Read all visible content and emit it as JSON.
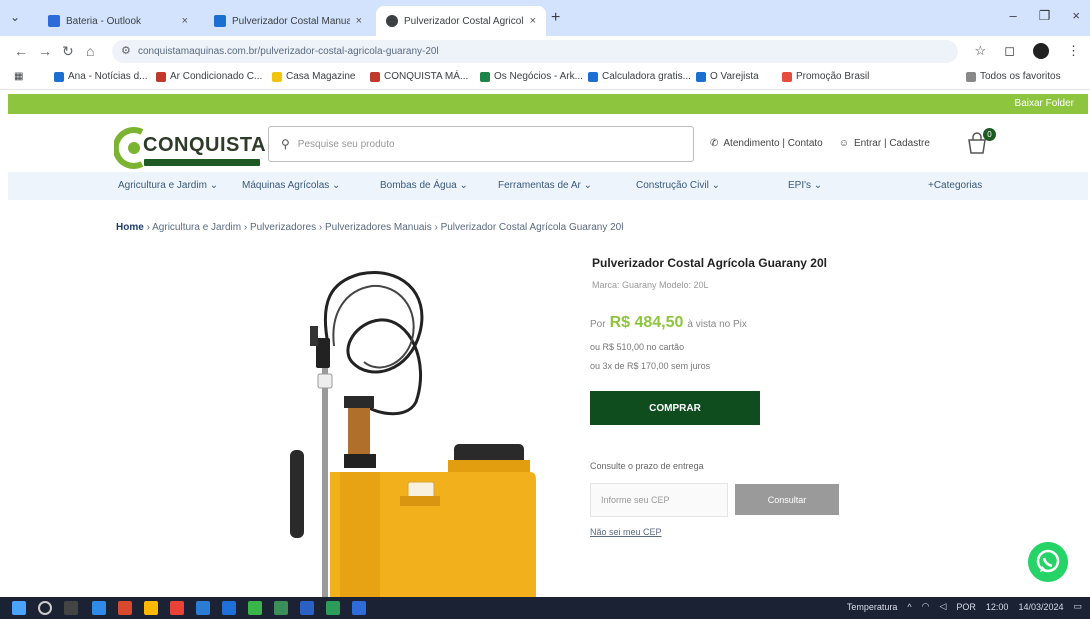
{
  "browser": {
    "tabs": [
      {
        "title": "Bateria - Outlook",
        "color": "#2b6cd8"
      },
      {
        "title": "Pulverizador Costal Manual Fl...",
        "color": "#1b6fd1"
      },
      {
        "title": "Pulverizador Costal Agricola G...",
        "color": "#3c4043"
      }
    ],
    "close_glyph": "×",
    "new_tab_glyph": "+",
    "url": "conquistamaquinas.com.br/pulverizador-costal-agricola-guarany-20l",
    "window_controls": [
      "–",
      "❐",
      "×"
    ],
    "bookmarks": [
      {
        "label": "Ana - Notícias d...",
        "color": "#1b6fd1"
      },
      {
        "label": "Ar Condicionado C...",
        "color": "#c0392b"
      },
      {
        "label": "Casa Magazine",
        "color": "#f1c40f"
      },
      {
        "label": "CONQUISTA MÁ...",
        "color": "#c0392b"
      },
      {
        "label": "Os Negócios - Ark...",
        "color": "#1e8449"
      },
      {
        "label": "Calculadora gratis...",
        "color": "#1b6fd1"
      },
      {
        "label": "O Varejista",
        "color": "#1b6fd1"
      },
      {
        "label": "Promoção Brasil",
        "color": "#e74c3c"
      },
      {
        "label": "Todos os favoritos",
        "color": "#888888"
      }
    ]
  },
  "site": {
    "topbar_link": "Baixar Folder",
    "logo": {
      "text": "CONQUISTA"
    },
    "search_placeholder": "Pesquise seu produto",
    "header_links": {
      "support": "Atendimento | Contato",
      "account": "Entrar | Cadastre"
    },
    "cart_count": "0",
    "menu": [
      "Agricultura e Jardim ⌄",
      "Máquinas Agrícolas ⌄",
      "Bombas de Água ⌄",
      "Ferramentas de Ar ⌄",
      "Construção Civil ⌄",
      "EPI's ⌄",
      "+Categorias"
    ],
    "breadcrumb": {
      "home": "Home",
      "rest": "› Agricultura e Jardim › Pulverizadores › Pulverizadores Manuais › Pulverizador Costal Agrícola Guarany 20l"
    }
  },
  "product": {
    "title": "Pulverizador Costal Agrícola Guarany 20l",
    "meta": "Marca: Guarany    Modelo: 20L",
    "price_prefix": "Por",
    "price": "R$ 484,50",
    "price_suffix": "à vista no Pix",
    "installment_line": "ou R$ 510,00 no cartão",
    "installment_line2": "ou 3x de R$ 170,00 sem juros",
    "buy_label": "COMPRAR",
    "shipping_label": "Consulte o prazo de entrega",
    "cep_placeholder": "Informe seu CEP",
    "cep_button": "Consultar",
    "cep_link": "Não sei meu CEP"
  },
  "taskbar": {
    "weather": "Temperatura",
    "time": "12:00",
    "date": "14/03/2024",
    "tray_lang": "POR"
  }
}
